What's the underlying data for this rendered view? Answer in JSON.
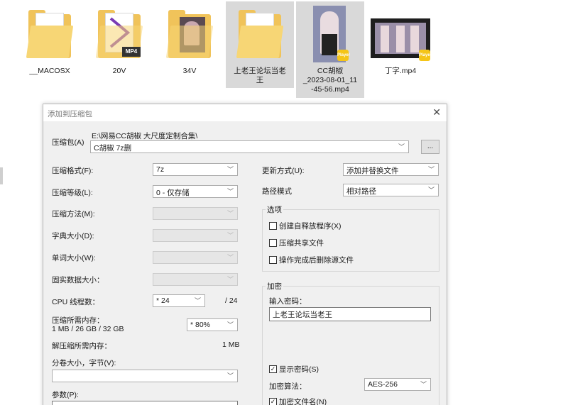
{
  "explorer": {
    "items": [
      {
        "name": "__MACOSX",
        "kind": "folder"
      },
      {
        "name": "20V",
        "kind": "folder-mp4",
        "tag": "MP4"
      },
      {
        "name": "34V",
        "kind": "folder-photo"
      },
      {
        "name": "上老王论坛当老王",
        "kind": "folder"
      },
      {
        "name": "CC胡椒_2023-08-01_11-45-56.mp4",
        "name_lines": [
          "CC胡椒",
          "_2023-08-01_11",
          "-45-56.mp4"
        ],
        "kind": "video",
        "badge": "Player"
      },
      {
        "name": "丁字.mp4",
        "kind": "video",
        "badge": "Player"
      }
    ]
  },
  "dialog": {
    "title": "添加到压缩包",
    "archive_label": "压缩包(A)",
    "archive_path": "E:\\网易CC胡椒 大尺度定制合集\\",
    "archive_name": "C胡椒 7z删",
    "browse_label": "...",
    "left": {
      "format_label": "压缩格式(F):",
      "format_value": "7z",
      "level_label": "压缩等级(L):",
      "level_value": "0 - 仅存储",
      "method_label": "压缩方法(M):",
      "dict_label": "字典大小(D):",
      "word_label": "单词大小(W):",
      "solid_label": "固实数据大小：",
      "cpu_label": "CPU 线程数：",
      "cpu_value": "* 24",
      "cpu_total": "/ 24",
      "mem_label": "压缩所需内存：",
      "mem_detail": "1 MB / 26 GB / 32 GB",
      "mem_value": "* 80%",
      "decomp_label": "解压缩所需内存：",
      "decomp_value": "1 MB",
      "split_label": "分卷大小，字节(V):",
      "params_label": "参数(P):"
    },
    "right": {
      "update_label": "更新方式(U):",
      "update_value": "添加并替换文件",
      "path_label": "路径模式",
      "path_value": "相对路径",
      "options_title": "选项",
      "options": [
        {
          "label": "创建自释放程序(X)",
          "checked": false
        },
        {
          "label": "压缩共享文件",
          "checked": false
        },
        {
          "label": "操作完成后删除源文件",
          "checked": false
        }
      ],
      "encrypt_title": "加密",
      "password_label": "输入密码：",
      "password_value": "上老王论坛当老王",
      "show_password_label": "显示密码(S)",
      "show_password_checked": true,
      "algo_label": "加密算法：",
      "algo_value": "AES-256",
      "encrypt_names_label": "加密文件名(N)",
      "encrypt_names_checked": true
    }
  },
  "icons": {
    "close": "close-icon",
    "dropdown": "chevron-down-icon",
    "check": "check-icon"
  }
}
